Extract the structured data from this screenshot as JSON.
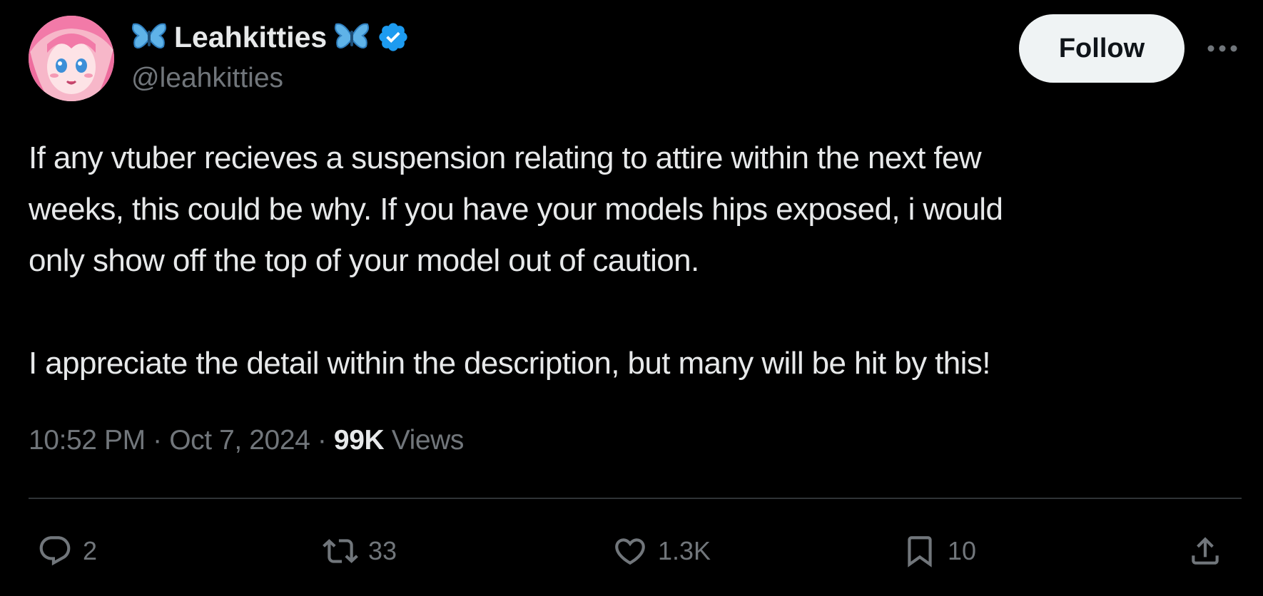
{
  "author": {
    "display_name": "Leahkitties",
    "handle": "@leahkitties",
    "verified": true,
    "name_emoji": "butterfly-icon"
  },
  "follow_button": {
    "label": "Follow"
  },
  "more_icon": "more-horizontal-icon",
  "tweet": {
    "paragraphs": [
      "If any vtuber recieves a suspension relating to attire within the next few",
      "weeks, this could be why. If you have your models hips exposed, i would",
      "only show off the top of your model out of caution.",
      "I appreciate the detail within the description, but many will be hit by this!"
    ]
  },
  "meta": {
    "time": "10:52 PM",
    "separator": "·",
    "date": "Oct 7, 2024",
    "views_count": "99K",
    "views_label": "Views"
  },
  "actions": {
    "reply": {
      "icon": "reply-icon",
      "count": "2"
    },
    "repost": {
      "icon": "repost-icon",
      "count": "33"
    },
    "like": {
      "icon": "heart-icon",
      "count": "1.3K"
    },
    "bookmark": {
      "icon": "bookmark-icon",
      "count": "10"
    },
    "share": {
      "icon": "share-icon"
    }
  },
  "colors": {
    "background": "#000000",
    "text_primary": "#e7e9ea",
    "text_secondary": "#71767b",
    "verified_blue": "#1d9bf0",
    "follow_button_bg": "#eff3f4",
    "butterfly_blue": "#5fb3e8",
    "divider": "#2f3336"
  }
}
